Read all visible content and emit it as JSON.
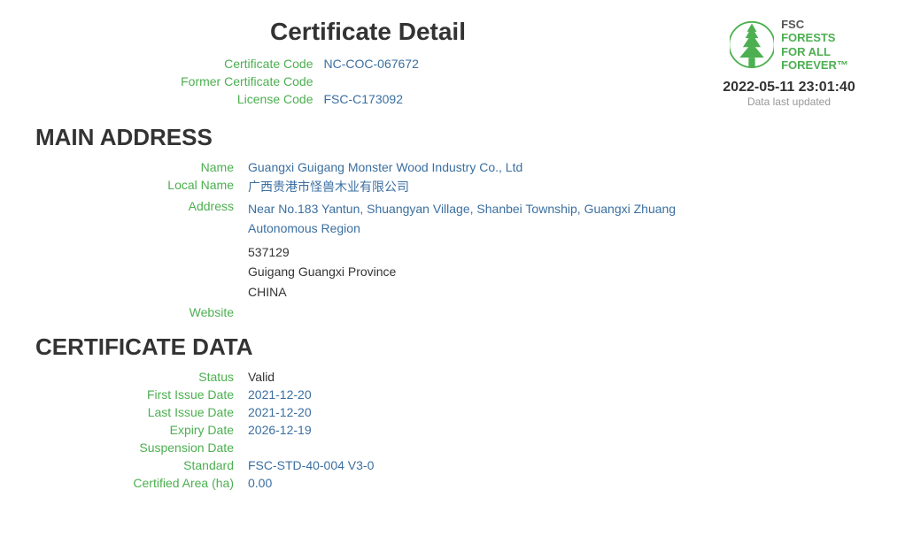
{
  "page": {
    "title": "Certificate Detail"
  },
  "logo": {
    "fsc_label": "FSC",
    "tagline_line1": "FORESTS",
    "tagline_line2": "FOR ALL",
    "tagline_line3": "FOREVER™"
  },
  "certificate_info": {
    "certificate_code_label": "Certificate Code",
    "certificate_code_value": "NC-COC-067672",
    "former_certificate_code_label": "Former Certificate Code",
    "former_certificate_code_value": "",
    "license_code_label": "License Code",
    "license_code_value": "FSC-C173092"
  },
  "timestamp": {
    "value": "2022-05-11 23:01:40",
    "label": "Data last updated"
  },
  "main_address": {
    "section_title": "MAIN ADDRESS",
    "name_label": "Name",
    "name_value": "Guangxi Guigang Monster Wood Industry Co., Ltd",
    "local_name_label": "Local Name",
    "local_name_value": "广西贵港市怪兽木业有限公司",
    "address_label": "Address",
    "address_line1": "Near No.183 Yantun, Shuangyan Village, Shanbei Township, Guangxi Zhuang",
    "address_line2": "Autonomous Region",
    "address_line3": "537129",
    "address_line4": "Guigang  Guangxi Province",
    "address_line5": "CHINA",
    "website_label": "Website",
    "website_value": ""
  },
  "certificate_data": {
    "section_title": "CERTIFICATE DATA",
    "status_label": "Status",
    "status_value": "Valid",
    "first_issue_date_label": "First Issue Date",
    "first_issue_date_value": "2021-12-20",
    "last_issue_date_label": "Last Issue Date",
    "last_issue_date_value": "2021-12-20",
    "expiry_date_label": "Expiry Date",
    "expiry_date_value": "2026-12-19",
    "suspension_date_label": "Suspension Date",
    "suspension_date_value": "",
    "standard_label": "Standard",
    "standard_value": "FSC-STD-40-004 V3-0",
    "certified_area_label": "Certified Area (ha)",
    "certified_area_value": "0.00"
  }
}
